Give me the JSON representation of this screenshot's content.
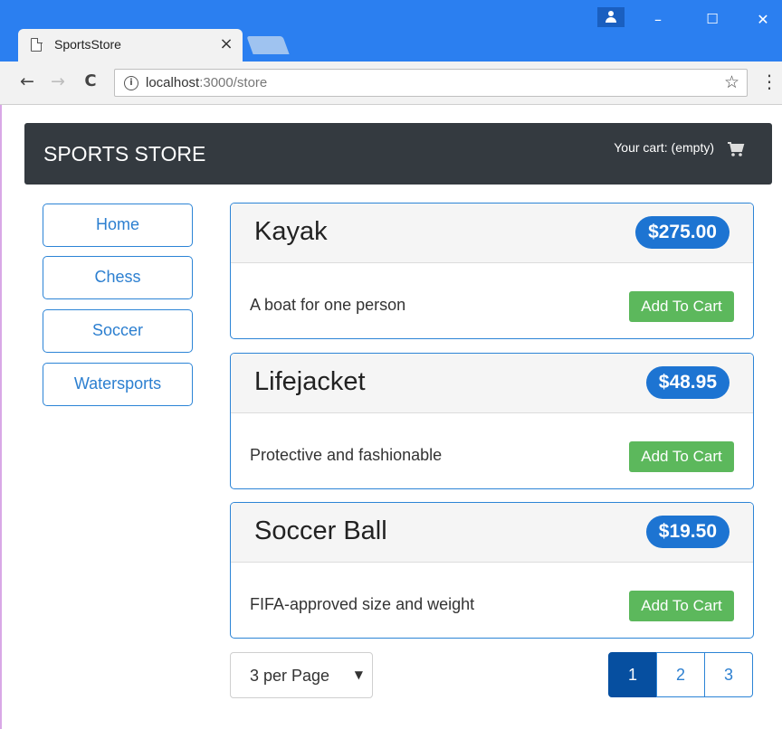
{
  "browser": {
    "tab_title": "SportsStore",
    "tab_close": "×",
    "url_host": "localhost",
    "url_rest": ":3000/store",
    "controls": {
      "minimize": "–",
      "maximize": "☐",
      "close": "✕"
    },
    "nav": {
      "back": "←",
      "forward": "→",
      "reload": "C"
    },
    "star": "☆",
    "menu": "⋮",
    "info": "i"
  },
  "store": {
    "brand": "SPORTS STORE",
    "cart_summary": "Your cart: (empty)"
  },
  "categories": [
    {
      "label": "Home"
    },
    {
      "label": "Chess"
    },
    {
      "label": "Soccer"
    },
    {
      "label": "Watersports"
    }
  ],
  "products": [
    {
      "name": "Kayak",
      "price": "$275.00",
      "description": "A boat for one person",
      "button": "Add To Cart"
    },
    {
      "name": "Lifejacket",
      "price": "$48.95",
      "description": "Protective and fashionable",
      "button": "Add To Cart"
    },
    {
      "name": "Soccer Ball",
      "price": "$19.50",
      "description": "FIFA-approved size and weight",
      "button": "Add To Cart"
    }
  ],
  "pagination": {
    "page_size_label": "3 per Page",
    "page_size_caret": "▼",
    "pages": [
      "1",
      "2",
      "3"
    ],
    "current_page": "1"
  },
  "colors": {
    "titlebar": "#2b7ff0",
    "navbar": "#343a40",
    "accent": "#2c84d6",
    "badge": "#1d74d2",
    "success": "#5cb85c",
    "active_page": "#064fa0"
  },
  "icons": {
    "page": "page-icon",
    "profile": "profile-icon",
    "info": "info-icon",
    "star": "star-icon",
    "menu": "menu-icon",
    "cart": "cart-icon"
  }
}
